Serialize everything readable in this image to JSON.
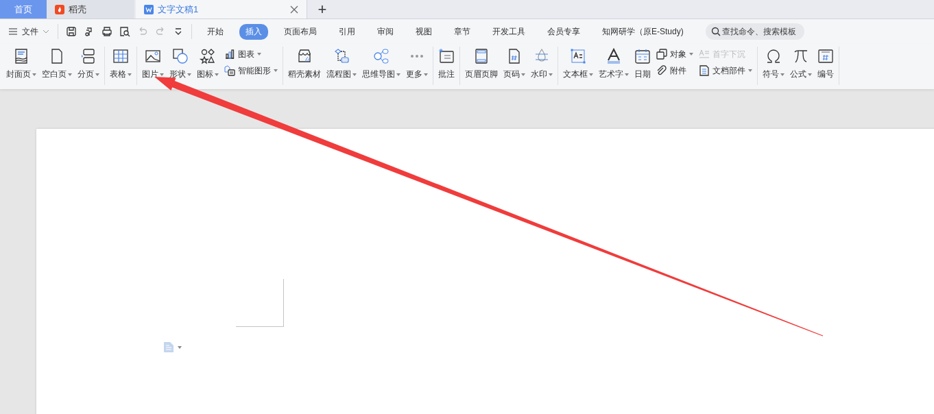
{
  "tabs": [
    {
      "label": "首页",
      "kind": "home",
      "selected": false
    },
    {
      "label": "稻壳",
      "kind": "docer",
      "selected": false
    },
    {
      "label": "文字文稿1",
      "kind": "document",
      "selected": true
    }
  ],
  "new_tab": "+",
  "file_menu": "文件",
  "quick_access": [
    {
      "disabled": false
    },
    {
      "disabled": false
    },
    {
      "disabled": false
    },
    {
      "disabled": false
    },
    {
      "disabled": true
    },
    {
      "disabled": true
    },
    {
      "disabled": false
    }
  ],
  "menu_tabs": [
    {
      "label": "开始",
      "selected": false
    },
    {
      "label": "插入",
      "selected": true
    },
    {
      "label": "页面布局",
      "selected": false
    },
    {
      "label": "引用",
      "selected": false
    },
    {
      "label": "审阅",
      "selected": false
    },
    {
      "label": "视图",
      "selected": false
    },
    {
      "label": "章节",
      "selected": false
    },
    {
      "label": "开发工具",
      "selected": false
    },
    {
      "label": "会员专享",
      "selected": false
    },
    {
      "label": "知网研学（原E-Study)",
      "selected": false
    }
  ],
  "search": {
    "placeholder": "查找命令、搜索模板"
  },
  "ribbon": [
    {
      "items": [
        {
          "kind": "large",
          "label": "封面页",
          "dropdown": true
        },
        {
          "kind": "large",
          "label": "空白页",
          "dropdown": true
        },
        {
          "kind": "large",
          "label": "分页",
          "dropdown": true
        }
      ]
    },
    {
      "items": [
        {
          "kind": "large",
          "label": "表格",
          "dropdown": true
        }
      ]
    },
    {
      "items": [
        {
          "kind": "large",
          "label": "图片",
          "dropdown": true
        },
        {
          "kind": "large",
          "label": "形状",
          "dropdown": true
        },
        {
          "kind": "large",
          "label": "图标",
          "dropdown": true
        },
        {
          "kind": "stack",
          "rows": [
            {
              "label": "图表",
              "dropdown": true,
              "disabled": false
            },
            {
              "label": "智能图形",
              "dropdown": true,
              "disabled": false
            }
          ]
        }
      ]
    },
    {
      "items": [
        {
          "kind": "large",
          "label": "稻壳素材",
          "dropdown": false
        },
        {
          "kind": "large",
          "label": "流程图",
          "dropdown": true
        },
        {
          "kind": "large",
          "label": "思维导图",
          "dropdown": true
        },
        {
          "kind": "large",
          "label": "更多",
          "dropdown": true
        }
      ]
    },
    {
      "items": [
        {
          "kind": "large",
          "label": "批注",
          "dropdown": false
        }
      ]
    },
    {
      "items": [
        {
          "kind": "large",
          "label": "页眉页脚",
          "dropdown": false
        },
        {
          "kind": "large",
          "label": "页码",
          "dropdown": true
        },
        {
          "kind": "large",
          "label": "水印",
          "dropdown": true
        }
      ]
    },
    {
      "items": [
        {
          "kind": "large",
          "label": "文本框",
          "dropdown": true
        },
        {
          "kind": "large",
          "label": "艺术字",
          "dropdown": true
        },
        {
          "kind": "large",
          "label": "日期",
          "dropdown": false
        },
        {
          "kind": "stack",
          "rows": [
            {
              "label": "对象",
              "dropdown": true,
              "disabled": false
            },
            {
              "label": "附件",
              "dropdown": false,
              "disabled": false
            }
          ]
        },
        {
          "kind": "stack",
          "rows": [
            {
              "label": "首字下沉",
              "dropdown": false,
              "disabled": true
            },
            {
              "label": "文档部件",
              "dropdown": true,
              "disabled": false
            }
          ]
        }
      ]
    },
    {
      "items": [
        {
          "kind": "large",
          "label": "符号",
          "dropdown": true
        },
        {
          "kind": "large",
          "label": "公式",
          "dropdown": true
        },
        {
          "kind": "large",
          "label": "编号",
          "dropdown": false
        }
      ]
    }
  ]
}
